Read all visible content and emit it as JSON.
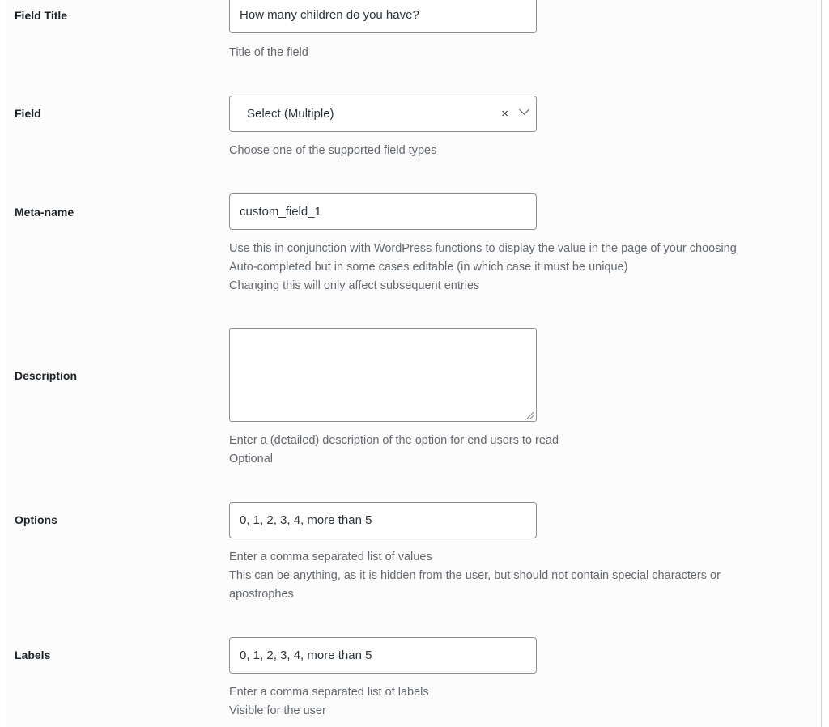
{
  "fields": [
    {
      "label": "Field Title",
      "value": "How many children do you have?",
      "help": [
        "Title of the field"
      ]
    },
    {
      "label": "Field",
      "value": "Select (Multiple)",
      "clear": "×",
      "help": [
        "Choose one of the supported field types"
      ]
    },
    {
      "label": "Meta-name",
      "value": "custom_field_1",
      "help": [
        "Use this in conjunction with WordPress functions to display the value in the page of your choosing",
        "Auto-completed but in some cases editable (in which case it must be unique)",
        "Changing this will only affect subsequent entries"
      ]
    },
    {
      "label": "Description",
      "value": "",
      "help": [
        "Enter a (detailed) description of the option for end users to read",
        "Optional"
      ]
    },
    {
      "label": "Options",
      "value": "0, 1, 2, 3, 4, more than 5",
      "help": [
        "Enter a comma separated list of values",
        "This can be anything, as it is hidden from the user, but should not contain special characters or",
        "apostrophes"
      ]
    },
    {
      "label": "Labels",
      "value": "0, 1, 2, 3, 4, more than 5",
      "help": [
        "Enter a comma separated list of labels",
        "Visible for the user"
      ]
    }
  ]
}
